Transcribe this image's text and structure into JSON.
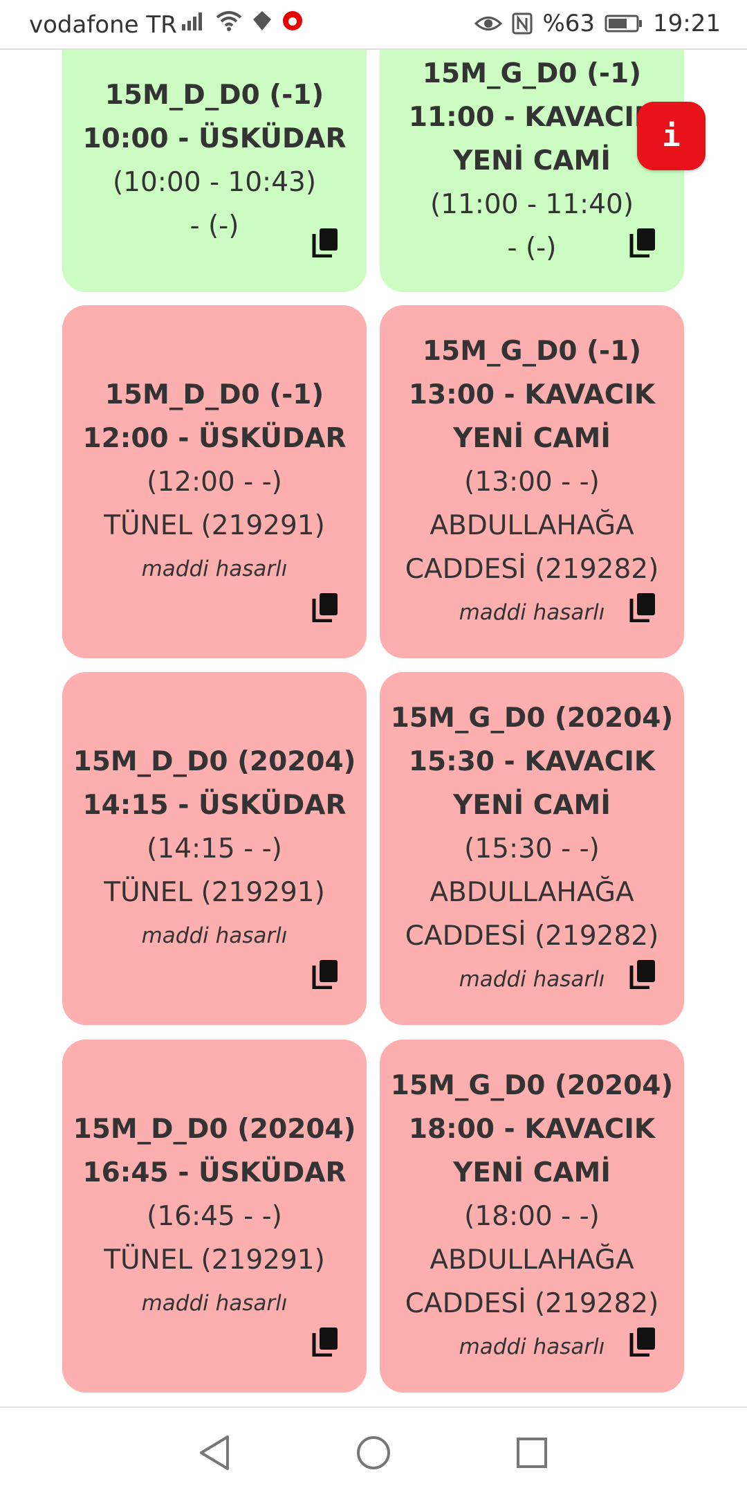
{
  "status_bar": {
    "carrier": "vodafone TR",
    "battery": "%63",
    "time": "19:21",
    "icons": [
      "signal-icon",
      "wifi-icon",
      "data-saver-icon",
      "vodafone-icon",
      "eye-comfort-icon",
      "nfc-icon",
      "battery-icon"
    ]
  },
  "info_button": {
    "label": "i",
    "color": "#e8121a"
  },
  "colors": {
    "green_card": "#ccfcc2",
    "red_card": "#fdaeae"
  },
  "cards": [
    {
      "status": "green",
      "title": "15M_D_D0 (-1)",
      "time_stop": "10:00 - ÜSKÜDAR",
      "range": "(10:00 - 10:43)",
      "stop": "- (-)",
      "note": ""
    },
    {
      "status": "green",
      "title": "15M_G_D0 (-1)",
      "time_stop": "11:00 - KAVACIK YENİ CAMİ",
      "range": "(11:00 - 11:40)",
      "stop": "- (-)",
      "note": ""
    },
    {
      "status": "red",
      "title": "15M_D_D0 (-1)",
      "time_stop": "12:00 - ÜSKÜDAR",
      "range": "(12:00 - -)",
      "stop": "TÜNEL (219291)",
      "note": "maddi hasarlı"
    },
    {
      "status": "red",
      "title": "15M_G_D0 (-1)",
      "time_stop": "13:00 - KAVACIK YENİ CAMİ",
      "range": "(13:00 - -)",
      "stop": "ABDULLAHAĞA CADDESİ (219282)",
      "note": "maddi hasarlı"
    },
    {
      "status": "red",
      "title": "15M_D_D0 (20204)",
      "time_stop": "14:15 - ÜSKÜDAR",
      "range": "(14:15 - -)",
      "stop": "TÜNEL (219291)",
      "note": "maddi hasarlı"
    },
    {
      "status": "red",
      "title": "15M_G_D0 (20204)",
      "time_stop": "15:30 - KAVACIK YENİ CAMİ",
      "range": "(15:30 - -)",
      "stop": "ABDULLAHAĞA CADDESİ (219282)",
      "note": "maddi hasarlı"
    },
    {
      "status": "red",
      "title": "15M_D_D0 (20204)",
      "time_stop": "16:45 - ÜSKÜDAR",
      "range": "(16:45 - -)",
      "stop": "TÜNEL (219291)",
      "note": "maddi hasarlı"
    },
    {
      "status": "red",
      "title": "15M_G_D0 (20204)",
      "time_stop": "18:00 - KAVACIK YENİ CAMİ",
      "range": "(18:00 - -)",
      "stop": "ABDULLAHAĞA CADDESİ (219282)",
      "note": "maddi hasarlı"
    }
  ],
  "nav_bar": {
    "buttons": [
      "back-icon",
      "home-icon",
      "recents-icon"
    ]
  }
}
